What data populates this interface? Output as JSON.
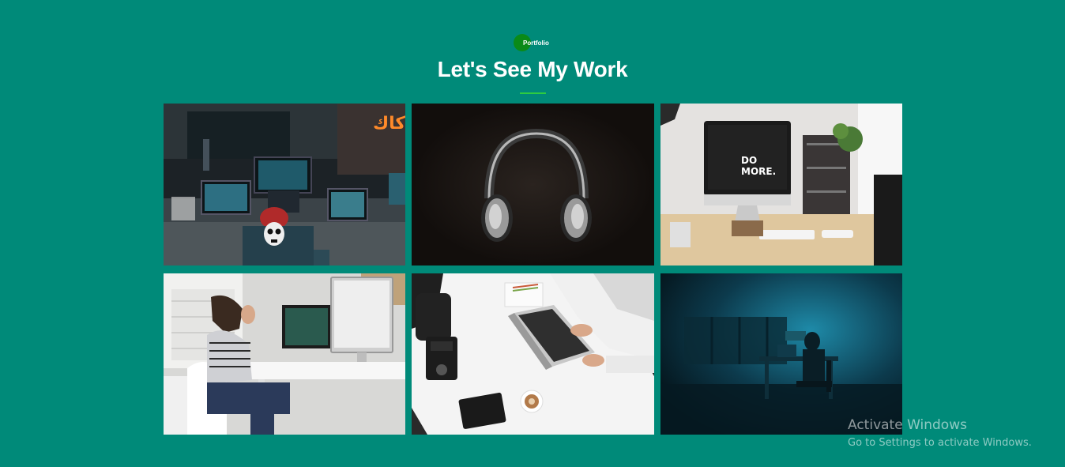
{
  "section": {
    "tag": "Portfolio",
    "title": "Let's See My Work"
  },
  "colors": {
    "background": "#008a79",
    "tag_dot": "#0a8a18",
    "underline": "#2ecc40"
  },
  "gallery": {
    "items": [
      {
        "subject": "hacker-office-photo"
      },
      {
        "subject": "headphones-photo"
      },
      {
        "subject": "imac-do-more-desk-photo"
      },
      {
        "subject": "woman-at-desk-photo"
      },
      {
        "subject": "laptop-top-down-photo"
      },
      {
        "subject": "dark-room-desk-photo"
      }
    ]
  },
  "imac_screen_text": [
    "DO",
    "MORE."
  ],
  "neon_sign_text": "كاك",
  "os_watermark": {
    "title": "Activate Windows",
    "subtitle": "Go to Settings to activate Windows."
  }
}
